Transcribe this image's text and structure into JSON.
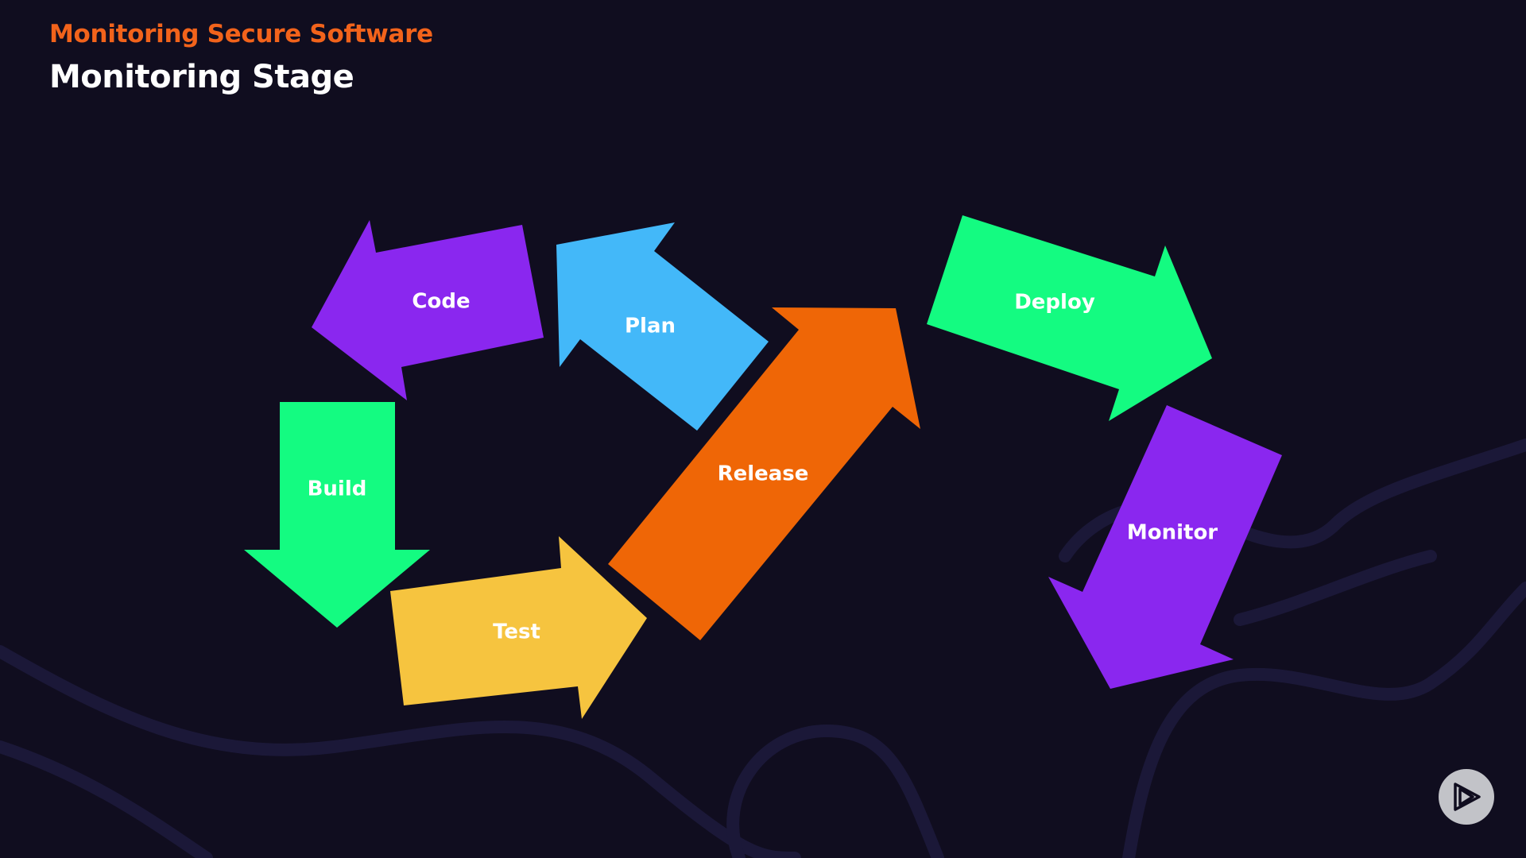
{
  "header": {
    "course_title": "Monitoring Secure Software",
    "slide_title": "Monitoring Stage"
  },
  "colors": {
    "background": "#100d1f",
    "accent": "#f2631b",
    "purple": "#8a27ef",
    "blue": "#43b8f9",
    "green": "#14fb81",
    "yellow": "#f6c43f",
    "orange": "#ef6606"
  },
  "stages": [
    {
      "id": "plan",
      "label": "Plan",
      "color": "#43b8f9"
    },
    {
      "id": "code",
      "label": "Code",
      "color": "#8a27ef"
    },
    {
      "id": "build",
      "label": "Build",
      "color": "#14fb81"
    },
    {
      "id": "test",
      "label": "Test",
      "color": "#f6c43f"
    },
    {
      "id": "release",
      "label": "Release",
      "color": "#ef6606"
    },
    {
      "id": "deploy",
      "label": "Deploy",
      "color": "#14fb81"
    },
    {
      "id": "monitor",
      "label": "Monitor",
      "color": "#8a27ef"
    }
  ],
  "controls": {
    "play_icon": "play-icon"
  }
}
